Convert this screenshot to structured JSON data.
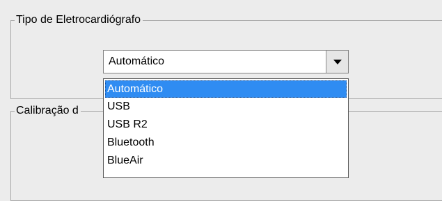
{
  "tipo_group": {
    "title": "Tipo de Eletrocardiógrafo"
  },
  "calibracao_group": {
    "title": "Calibração d"
  },
  "combo": {
    "selected_value": "Automático",
    "icon": "chevron-down-icon"
  },
  "dropdown": {
    "options": [
      "Automático",
      "USB",
      "USB R2",
      "Bluetooth",
      "BlueAir"
    ],
    "highlighted": "Automático"
  },
  "colors": {
    "highlight": "#2f8cf2",
    "window_bg": "#ececec"
  }
}
